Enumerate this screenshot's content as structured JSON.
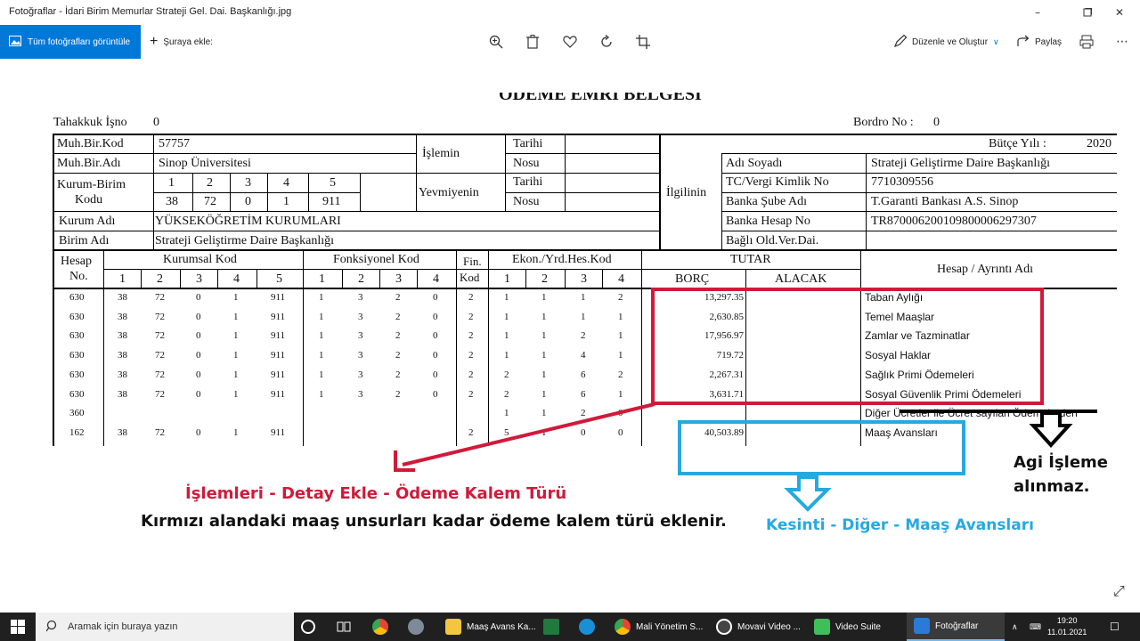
{
  "window": {
    "title": "Fotoğraflar - İdari Birim Memurlar Strateji Gel. Dai. Başkanlığı.jpg",
    "minimize_icon": "minimize-icon",
    "maximize_icon": "maximize-icon",
    "close_icon": "close-icon"
  },
  "toolbar": {
    "all_photos_label": "Tüm fotoğrafları görüntüle",
    "add_to_label": "Şuraya ekle:",
    "edit_create_label": "Düzenle ve Oluştur",
    "share_label": "Paylaş"
  },
  "document": {
    "top_cut_text": "ÖDEME EMRİ BELGESİ",
    "tahakkuk_label": "Tahakkuk İşno",
    "tahakkuk_value": "0",
    "bordro_label": "Bordro No :",
    "bordro_value": "0",
    "muh_kod_label": "Muh.Bir.Kod",
    "muh_kod_value": "57757",
    "muh_adi_label": "Muh.Bir.Adı",
    "muh_adi_value": "Sinop Üniversitesi",
    "kurum_birim_label1": "Kurum-Birim",
    "kurum_birim_label2": "Kodu",
    "kb_heads": [
      "1",
      "2",
      "3",
      "4",
      "5"
    ],
    "kb_values": [
      "38",
      "72",
      "0",
      "1",
      "911"
    ],
    "kurum_adi_label": "Kurum Adı",
    "kurum_adi_value": "YÜKSEKÖĞRETİM KURUMLARI",
    "birim_adi_label": "Birim Adı",
    "birim_adi_value": "Strateji Geliştirme Daire Başkanlığı",
    "islemin_label": "İşlemin",
    "yevmiyenin_label": "Yevmiyenin",
    "tarihi_label": "Tarihi",
    "nosu_label": "Nosu",
    "ilgilinin_label": "İlgilinin",
    "butce_yili_label": "Bütçe Yılı :",
    "butce_yili_value": "2020",
    "adi_soyadi_label": "Adı Soyadı",
    "adi_soyadi_value": "Strateji Geliştirme Daire Başkanlığı",
    "vergi_label": "TC/Vergi Kimlik No",
    "vergi_value": "7710309556",
    "banka_sube_label": "Banka Şube Adı",
    "banka_sube_value": "T.Garanti Bankası A.S. Sinop",
    "banka_hesap_label": "Banka Hesap No",
    "banka_hesap_value": "TR870006200109800006297307",
    "bagli_label": "Bağlı Old.Ver.Dai.",
    "hesap_no_label1": "Hesap",
    "hesap_no_label2": "No.",
    "kurumsal_kod_label": "Kurumsal Kod",
    "fonksiyonel_kod_label": "Fonksiyonel Kod",
    "fin_kod_label1": "Fin.",
    "fin_kod_label2": "Kod",
    "ekon_label": "Ekon./Yrd.Hes.Kod",
    "tutar_label": "TUTAR",
    "borc_label": "BORÇ",
    "alacak_label": "ALACAK",
    "hesap_adi_label": "Hesap / Ayrıntı Adı",
    "kurumsal_sub": [
      "1",
      "2",
      "3",
      "4",
      "5"
    ],
    "fonksiyonel_sub": [
      "1",
      "2",
      "3",
      "4"
    ],
    "ekon_sub": [
      "1",
      "2",
      "3",
      "4"
    ],
    "rows": [
      {
        "hesap": "630",
        "k1": "38",
        "k2": "72",
        "k3": "0",
        "k4": "1",
        "k5": "911",
        "f1": "1",
        "f2": "3",
        "f3": "2",
        "f4": "0",
        "fin": "2",
        "e1": "1",
        "e2": "1",
        "e3": "1",
        "e4": "2",
        "borc": "13,297.35",
        "ad": "Taban Aylığı"
      },
      {
        "hesap": "630",
        "k1": "38",
        "k2": "72",
        "k3": "0",
        "k4": "1",
        "k5": "911",
        "f1": "1",
        "f2": "3",
        "f3": "2",
        "f4": "0",
        "fin": "2",
        "e1": "1",
        "e2": "1",
        "e3": "1",
        "e4": "1",
        "borc": "2,630.85",
        "ad": "Temel Maaşlar"
      },
      {
        "hesap": "630",
        "k1": "38",
        "k2": "72",
        "k3": "0",
        "k4": "1",
        "k5": "911",
        "f1": "1",
        "f2": "3",
        "f3": "2",
        "f4": "0",
        "fin": "2",
        "e1": "1",
        "e2": "1",
        "e3": "2",
        "e4": "1",
        "borc": "17,956.97",
        "ad": "Zamlar ve Tazminatlar"
      },
      {
        "hesap": "630",
        "k1": "38",
        "k2": "72",
        "k3": "0",
        "k4": "1",
        "k5": "911",
        "f1": "1",
        "f2": "3",
        "f3": "2",
        "f4": "0",
        "fin": "2",
        "e1": "1",
        "e2": "1",
        "e3": "4",
        "e4": "1",
        "borc": "719.72",
        "ad": "Sosyal Haklar"
      },
      {
        "hesap": "630",
        "k1": "38",
        "k2": "72",
        "k3": "0",
        "k4": "1",
        "k5": "911",
        "f1": "1",
        "f2": "3",
        "f3": "2",
        "f4": "0",
        "fin": "2",
        "e1": "2",
        "e2": "1",
        "e3": "6",
        "e4": "2",
        "borc": "2,267.31",
        "ad": "Sağlık Primi Ödemeleri"
      },
      {
        "hesap": "630",
        "k1": "38",
        "k2": "72",
        "k3": "0",
        "k4": "1",
        "k5": "911",
        "f1": "1",
        "f2": "3",
        "f3": "2",
        "f4": "0",
        "fin": "2",
        "e1": "2",
        "e2": "1",
        "e3": "6",
        "e4": "1",
        "borc": "3,631.71",
        "ad": "Sosyal Güvenlik Primi Ödemeleri"
      },
      {
        "hesap": "360",
        "k1": "",
        "k2": "",
        "k3": "",
        "k4": "",
        "k5": "",
        "f1": "",
        "f2": "",
        "f3": "",
        "f4": "",
        "fin": "",
        "e1": "1",
        "e2": "1",
        "e3": "2",
        "e4": "0",
        "borc": "",
        "ad": "Diğer Ücretler ile Ücret sayılan Ödemelerden"
      },
      {
        "hesap": "162",
        "k1": "38",
        "k2": "72",
        "k3": "0",
        "k4": "1",
        "k5": "911",
        "f1": "",
        "f2": "",
        "f3": "",
        "f4": "",
        "fin": "2",
        "e1": "5",
        "e2": "1",
        "e3": "0",
        "e4": "0",
        "borc": "40,503.89",
        "ad": "Maaş Avansları"
      }
    ]
  },
  "annotations": {
    "red_title": "İşlemleri - Detay Ekle - Ödeme Kalem Türü",
    "black_text": "Kırmızı alandaki maaş unsurları kadar ödeme kalem türü eklenir.",
    "blue_text": "Kesinti - Diğer - Maaş Avansları",
    "agi_line1": "Agi İşleme",
    "agi_line2": "alınmaz.",
    "red_color": "#d11a3a",
    "blue_color": "#25a9e0"
  },
  "taskbar": {
    "search_placeholder": "Aramak için buraya yazın",
    "items": [
      {
        "label": "Maaş Avans Ka...",
        "icon": "folder-icon"
      },
      {
        "label": "Mali Yönetim S...",
        "icon": "chrome-icon"
      },
      {
        "label": "Movavi Video ...",
        "icon": "movavi-icon"
      },
      {
        "label": "Video Suite",
        "icon": "video-suite-icon"
      },
      {
        "label": "Fotoğraflar",
        "icon": "photos-icon"
      }
    ],
    "time": "19:20",
    "date": "11.01.2021"
  }
}
